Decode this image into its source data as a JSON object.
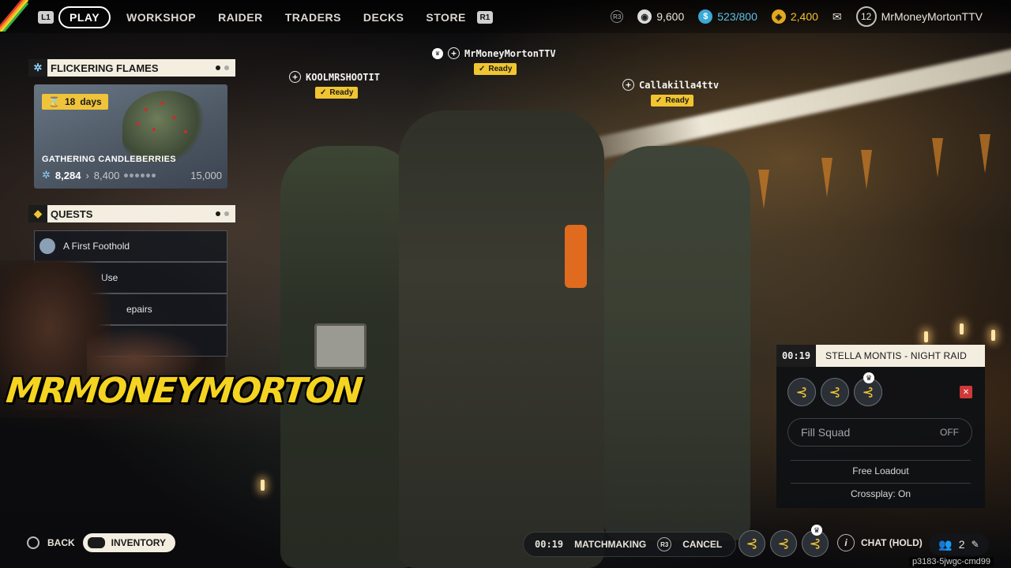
{
  "top_nav": {
    "left_button": "L1",
    "right_button": "R1",
    "items": [
      {
        "label": "PLAY",
        "active": true
      },
      {
        "label": "WORKSHOP",
        "active": false
      },
      {
        "label": "RAIDER",
        "active": false
      },
      {
        "label": "TRADERS",
        "active": false
      },
      {
        "label": "DECKS",
        "active": false
      },
      {
        "label": "STORE",
        "active": false
      }
    ]
  },
  "currency": {
    "r3_label": "R3",
    "coins": "9,600",
    "blue_value": "523/800",
    "gold_value": "2,400",
    "level": "12",
    "username": "MrMoneyMortonTTV"
  },
  "event": {
    "title": "FLICKERING FLAMES",
    "days_left": "18",
    "days_unit": "days",
    "card_title": "GATHERING CANDLEBERRIES",
    "current": "8,284",
    "next": "8,400",
    "max": "15,000"
  },
  "quests": {
    "title": "QUESTS",
    "items": [
      {
        "label": "A First Foothold"
      },
      {
        "label": "Use"
      },
      {
        "label": "epairs"
      },
      {
        "label": ""
      }
    ]
  },
  "players": [
    {
      "name": "KOOLMRSHOOTIT",
      "status": "Ready"
    },
    {
      "name": "MrMoneyMortonTTV",
      "status": "Ready"
    },
    {
      "name": "Callakilla4ttv",
      "status": "Ready"
    }
  ],
  "streamer_overlay": "MRMONEYMORTON",
  "squad": {
    "timer": "00:19",
    "mode": "STELLA MONTIS - NIGHT RAID",
    "fill_label": "Fill Squad",
    "fill_state": "OFF",
    "loadout": "Free Loadout",
    "crossplay": "Crossplay: On"
  },
  "bottom": {
    "back_label": "BACK",
    "inventory_label": "INVENTORY",
    "mm_timer": "00:19",
    "mm_label": "MATCHMAKING",
    "mm_button": "R3",
    "cancel_label": "CANCEL",
    "chat_label": "CHAT (HOLD)",
    "party_count": "2",
    "build_id": "p3183-5jwgc-cmd99"
  }
}
